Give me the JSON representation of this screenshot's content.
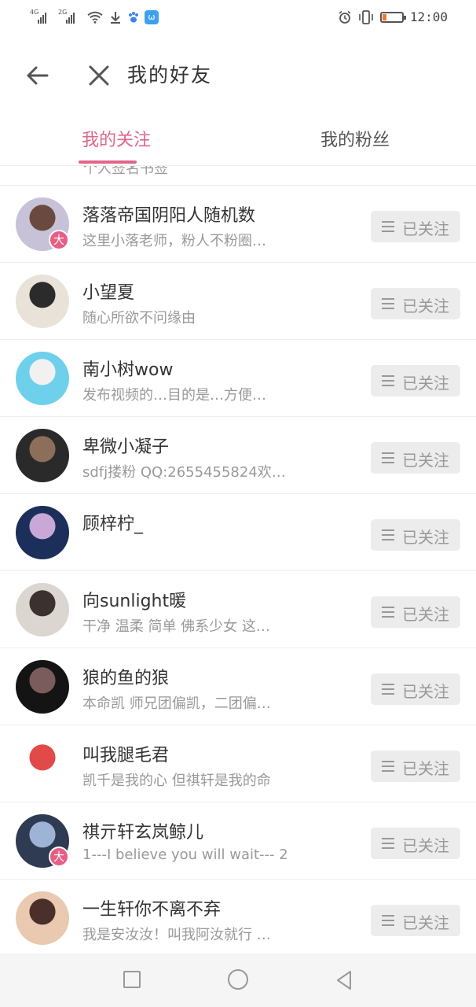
{
  "status_bar": {
    "signal1_label": "4G",
    "signal2_label": "2G",
    "time": "12:00",
    "baidu_icon": "paw-icon",
    "app_icon_text": "ω"
  },
  "header": {
    "title": "我的好友"
  },
  "tabs": [
    {
      "label": "我的关注",
      "active": true
    },
    {
      "label": "我的粉丝",
      "active": false
    }
  ],
  "partial_row_text": "个人签名书签",
  "follow_label": "已关注",
  "users": [
    {
      "name": "落落帝国阴阳人随机数",
      "desc": "这里小落老师，粉人不粉圈…",
      "badge": "大",
      "avatar_colors": [
        "#c7c2d8",
        "#6a4a3e"
      ]
    },
    {
      "name": "小望夏",
      "desc": "随心所欲不问缘由",
      "badge": "",
      "avatar_colors": [
        "#e9e2d8",
        "#2b2b2b"
      ]
    },
    {
      "name": "南小树wow",
      "desc": "发布视频的…目的是…方便…",
      "badge": "",
      "avatar_colors": [
        "#6fd0ec",
        "#f1f1f1"
      ]
    },
    {
      "name": "卑微小凝子",
      "desc": "sdfj搂粉 QQ:2655455824欢…",
      "badge": "",
      "avatar_colors": [
        "#2a2a2a",
        "#8d6e5a"
      ]
    },
    {
      "name": "顾梓柠_",
      "desc": "",
      "badge": "",
      "avatar_colors": [
        "#1c2f5a",
        "#c9a7d6"
      ]
    },
    {
      "name": "向sunlight暖",
      "desc": "干净 温柔 简单 佛系少女 这…",
      "badge": "",
      "avatar_colors": [
        "#dcd6d0",
        "#3b3230"
      ]
    },
    {
      "name": "狼的鱼的狼",
      "desc": "本命凯 师兄团偏凯，二团偏…",
      "badge": "",
      "avatar_colors": [
        "#141414",
        "#7a5c5c"
      ]
    },
    {
      "name": "叫我腿毛君",
      "desc": "凯千是我的心 但祺轩是我的命",
      "badge": "",
      "avatar_colors": [
        "#ffffff",
        "#e24a4a"
      ]
    },
    {
      "name": "祺亓轩玄岚鲸儿",
      "desc": "1---I believe you will wait--- 2",
      "badge": "大",
      "avatar_colors": [
        "#2f3b52",
        "#9db4d6"
      ]
    },
    {
      "name": "一生轩你不离不弃",
      "desc": "我是安汝汝！叫我阿汝就行 …",
      "badge": "",
      "avatar_colors": [
        "#e9c9b0",
        "#4a2f2a"
      ]
    }
  ],
  "colors": {
    "accent": "#e0668a",
    "badge": "#e55f86",
    "follow_bg": "#ececec"
  }
}
